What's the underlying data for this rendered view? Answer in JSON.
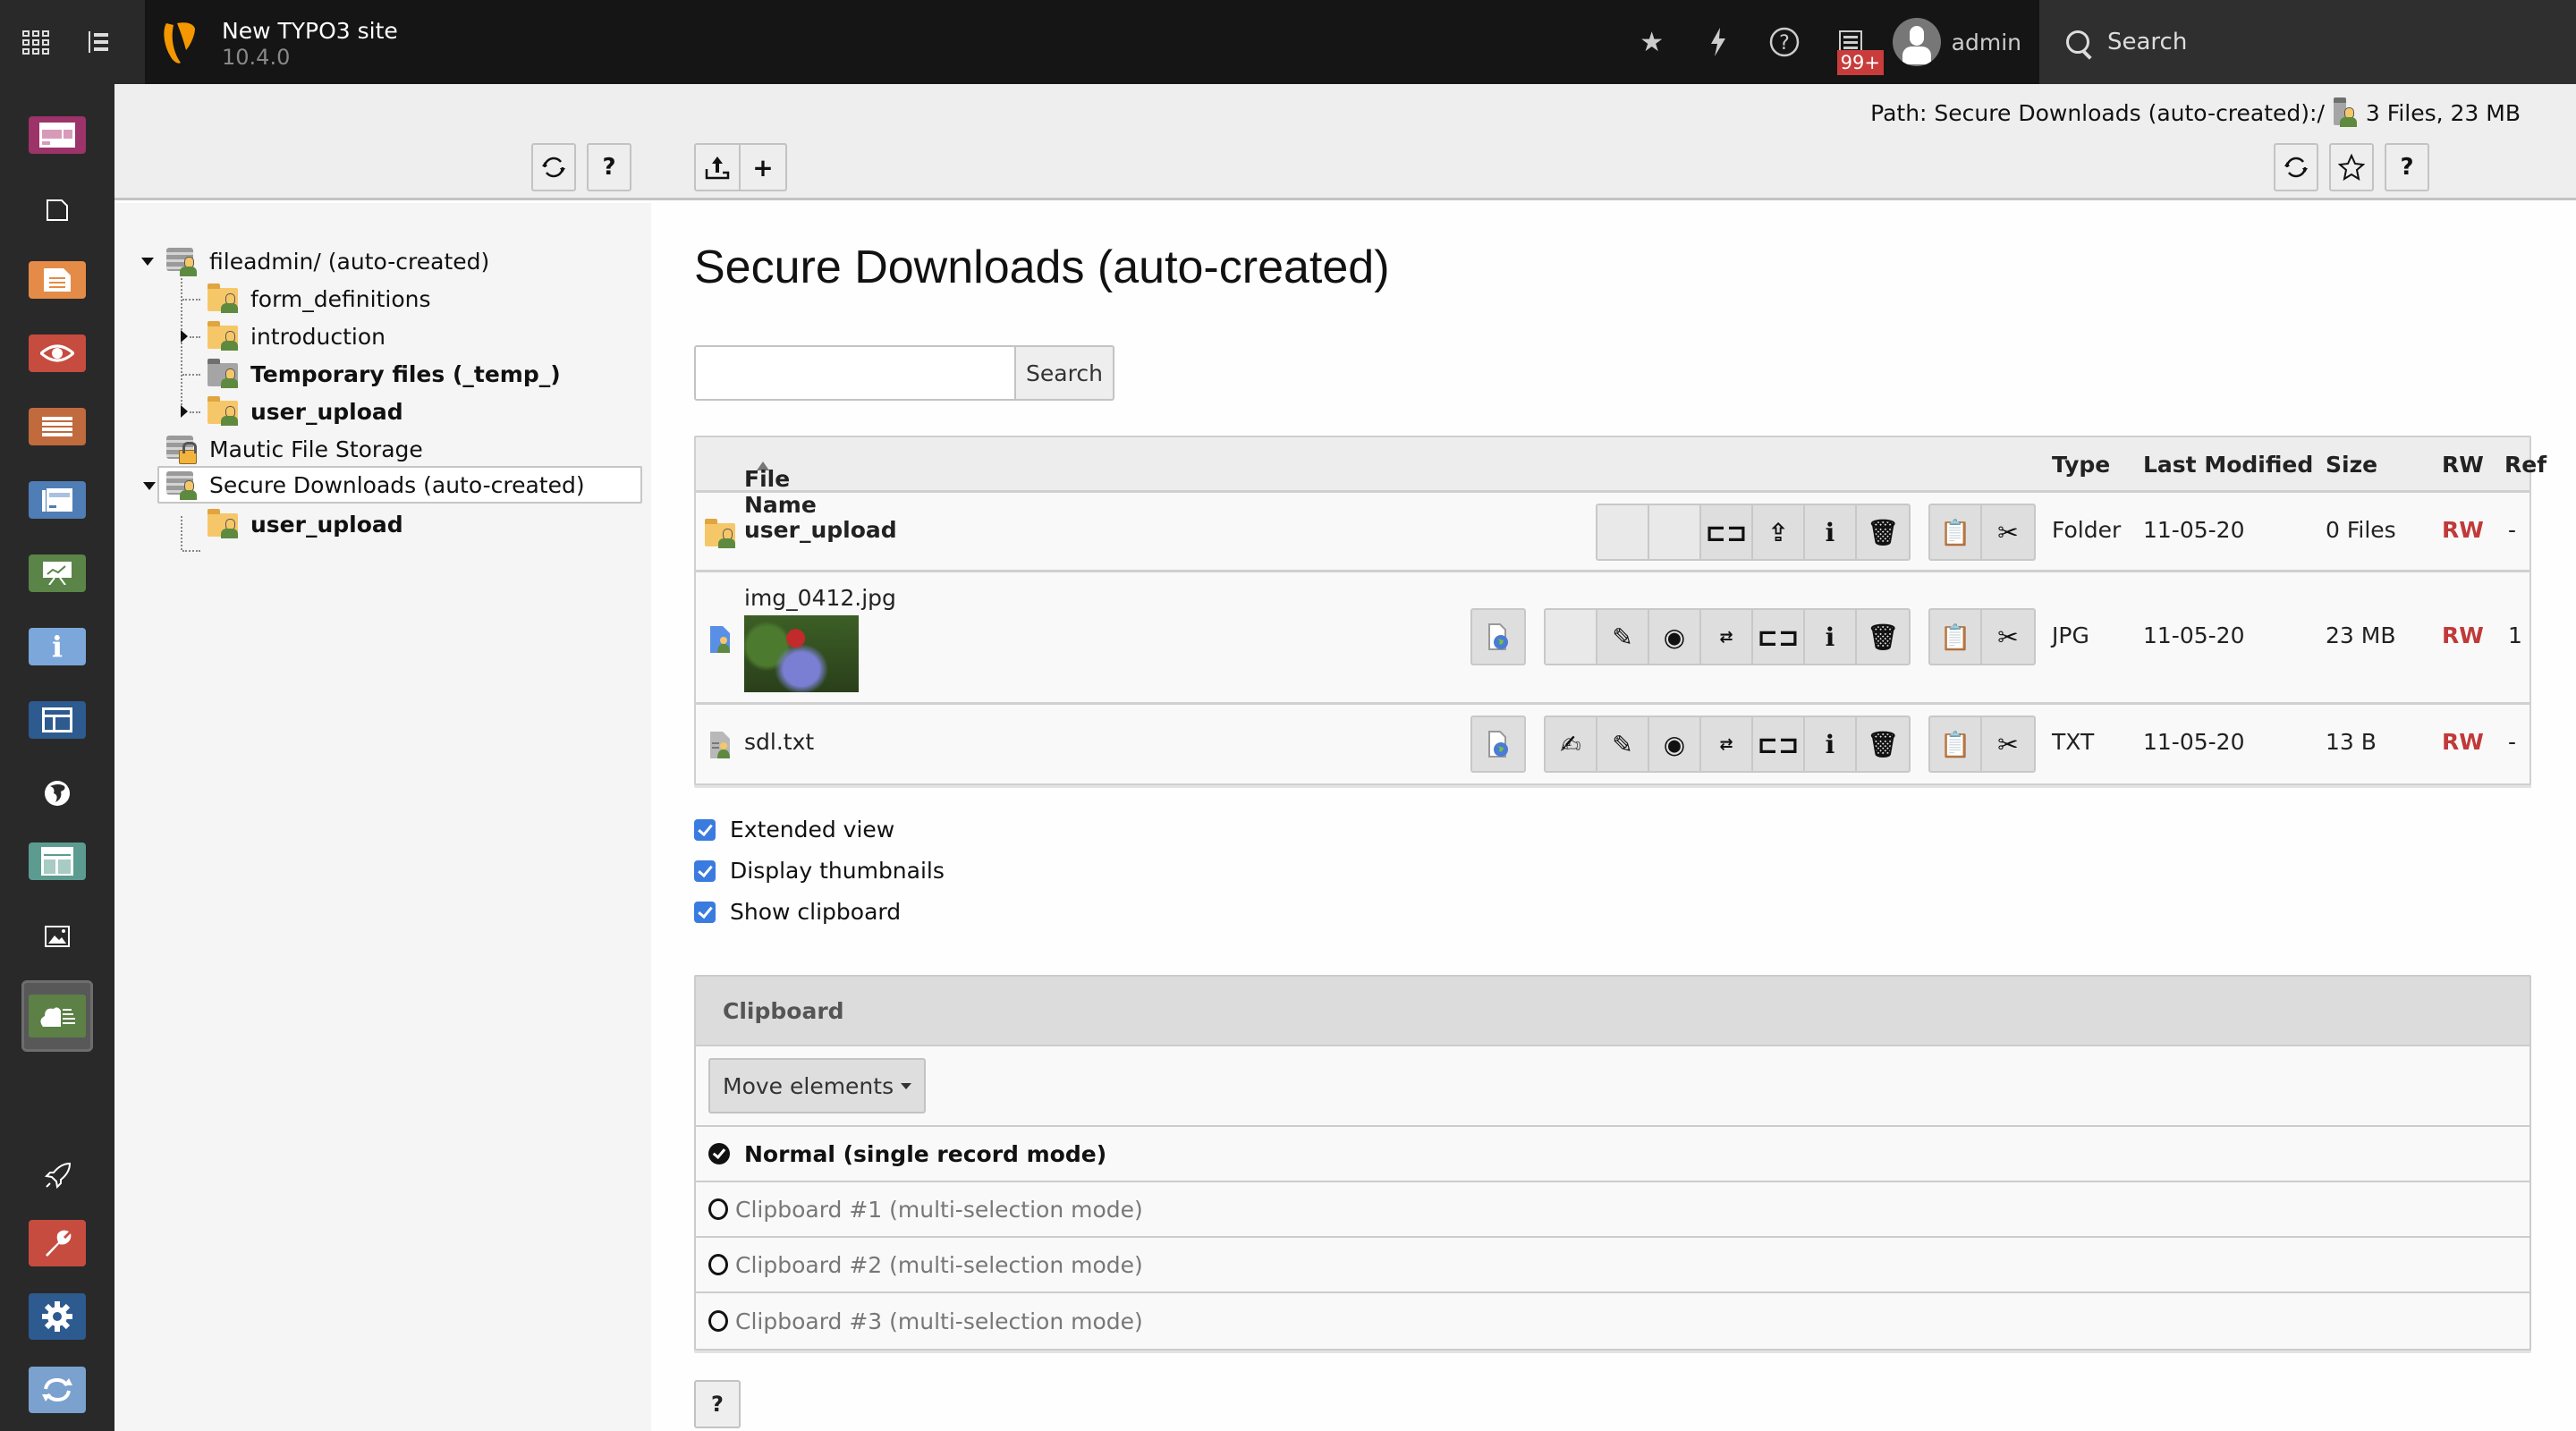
{
  "topbar": {
    "site_name": "New TYPO3 site",
    "version": "10.4.0",
    "icons": [
      "module-menu-toggle-icon",
      "tree-toggle-icon",
      "bookmark-star-icon",
      "flash-clear-cache-icon",
      "help-icon",
      "system-information-icon"
    ],
    "notification_badge": "99+",
    "user_name": "admin",
    "search_label": "Search"
  },
  "modules": [
    {
      "name": "dashboard",
      "color": "#9c3369"
    },
    {
      "name": "page",
      "color": null
    },
    {
      "name": "web-page",
      "color": "#e48b47"
    },
    {
      "name": "view",
      "color": "#c64c3f"
    },
    {
      "name": "list",
      "color": "#c06a3e"
    },
    {
      "name": "news",
      "color": "#4f7db5"
    },
    {
      "name": "reports",
      "color": "#5a8448"
    },
    {
      "name": "info",
      "color": "#7ba7da"
    },
    {
      "name": "template",
      "color": "#2d5a8f"
    },
    {
      "name": "sites",
      "color": null
    },
    {
      "name": "site-management",
      "color": "#5c9c90"
    },
    {
      "name": "media",
      "color": null
    },
    {
      "name": "filelist",
      "color": "#5c8046"
    },
    {
      "name": "admin-tools",
      "color": null
    },
    {
      "name": "maintenance",
      "color": "#c64c3f"
    },
    {
      "name": "settings",
      "color": "#2d5a8f"
    },
    {
      "name": "upgrade",
      "color": "#7ba1cf"
    }
  ],
  "docheader": {
    "path_label": "Path: Secure Downloads (auto-created):/",
    "summary": "3 Files, 23 MB",
    "tree_buttons": [
      "refresh",
      "help"
    ],
    "action_buttons": [
      "upload",
      "new"
    ],
    "right_buttons": [
      "reload",
      "bookmark",
      "help"
    ]
  },
  "tree": {
    "nodes": [
      {
        "label": "fileadmin/ (auto-created)",
        "type": "storage",
        "level": 0,
        "expanded": true,
        "bold": false
      },
      {
        "label": "form_definitions",
        "type": "folder",
        "level": 1,
        "bold": false
      },
      {
        "label": "introduction",
        "type": "folder",
        "level": 1,
        "collapsed": true,
        "bold": false
      },
      {
        "label": "Temporary files (_temp_)",
        "type": "temp-folder",
        "level": 1,
        "bold": true
      },
      {
        "label": "user_upload",
        "type": "folder",
        "level": 1,
        "collapsed": true,
        "bold": true
      },
      {
        "label": "Mautic File Storage",
        "type": "locked-storage",
        "level": 0,
        "bold": false
      },
      {
        "label": "Secure Downloads (auto-created)",
        "type": "storage",
        "level": 0,
        "expanded": true,
        "selected": true,
        "bold": false
      },
      {
        "label": "user_upload",
        "type": "folder",
        "level": 1,
        "bold": true
      }
    ]
  },
  "main": {
    "title": "Secure Downloads (auto-created)",
    "search": {
      "value": "",
      "placeholder": "",
      "button": "Search"
    },
    "table": {
      "columns": {
        "name": "File Name",
        "type": "Type",
        "modified": "Last Modified",
        "size": "Size",
        "rw": "RW",
        "ref": "Ref"
      },
      "sort": "ascending",
      "rows": [
        {
          "name": "user_upload",
          "kind": "folder",
          "type": "Folder",
          "modified": "11-05-20",
          "size": "0 Files",
          "rw": "RW",
          "ref": "-"
        },
        {
          "name": "img_0412.jpg",
          "kind": "image",
          "type": "JPG",
          "modified": "11-05-20",
          "size": "23 MB",
          "rw": "RW",
          "ref": "1"
        },
        {
          "name": "sdl.txt",
          "kind": "text",
          "type": "TXT",
          "modified": "11-05-20",
          "size": "13 B",
          "rw": "RW",
          "ref": "-"
        }
      ]
    },
    "options": [
      {
        "label": "Extended view",
        "checked": true
      },
      {
        "label": "Display thumbnails",
        "checked": true
      },
      {
        "label": "Show clipboard",
        "checked": true
      }
    ],
    "clipboard": {
      "title": "Clipboard",
      "mode_button": "Move elements",
      "pads": [
        {
          "label": "Normal (single record mode)",
          "active": true
        },
        {
          "label": "Clipboard #1 (multi-selection mode)",
          "active": false
        },
        {
          "label": "Clipboard #2 (multi-selection mode)",
          "active": false
        },
        {
          "label": "Clipboard #3 (multi-selection mode)",
          "active": false
        }
      ]
    },
    "help_label": "?"
  },
  "colors": {
    "topbar": "#151515",
    "rw": "#c03a3a",
    "checkbox": "#3a7bdf",
    "badge": "#c83c3c",
    "typo3_orange": "#f49700"
  }
}
